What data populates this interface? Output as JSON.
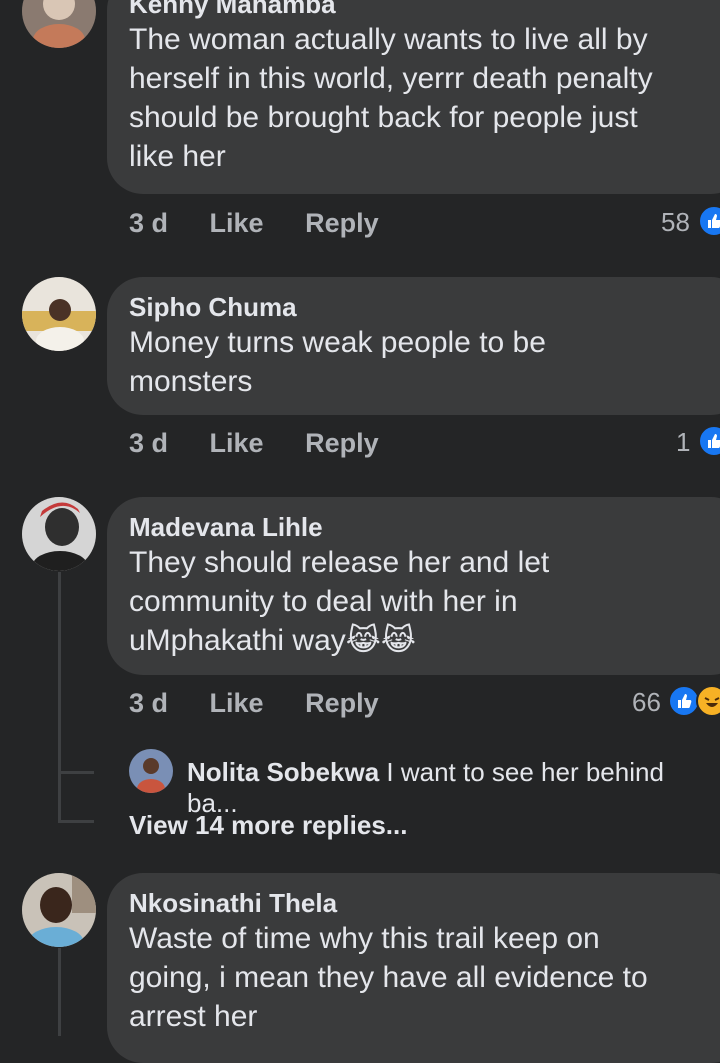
{
  "comments": [
    {
      "author": "Kenny Mahamba",
      "lines": [
        "The woman actually wants to live all by",
        "herself in this world, yerrr death penalty",
        "should be brought back for people just",
        "like her"
      ],
      "time": "3 d",
      "like_label": "Like",
      "reply_label": "Reply",
      "reaction_count": "58"
    },
    {
      "author": "Sipho Chuma",
      "lines": [
        "Money turns weak people to be",
        "monsters"
      ],
      "time": "3 d",
      "like_label": "Like",
      "reply_label": "Reply",
      "reaction_count": "1"
    },
    {
      "author": "Madevana Lihle",
      "lines": [
        "They should release her and let",
        "community to deal with her in",
        "uMphakathi way"
      ],
      "emoji": "😹😹",
      "time": "3 d",
      "like_label": "Like",
      "reply_label": "Reply",
      "reaction_count": "66",
      "reply_preview": {
        "author": "Nolita Sobekwa",
        "text": "I want to see her behind ba..."
      },
      "more_replies": "View 14 more replies..."
    },
    {
      "author": "Nkosinathi Thela",
      "lines": [
        "Waste of time why this trail keep on",
        "going, i mean they have all evidence to",
        "arrest her"
      ]
    }
  ],
  "colors": {
    "background": "#242526",
    "bubble": "#3a3b3c",
    "like_blue": "#1877f2",
    "meta_gray": "#b0b3b8"
  },
  "icons": [
    "like-reaction-icon",
    "haha-reaction-icon",
    "cat-tears-of-joy-emoji"
  ]
}
